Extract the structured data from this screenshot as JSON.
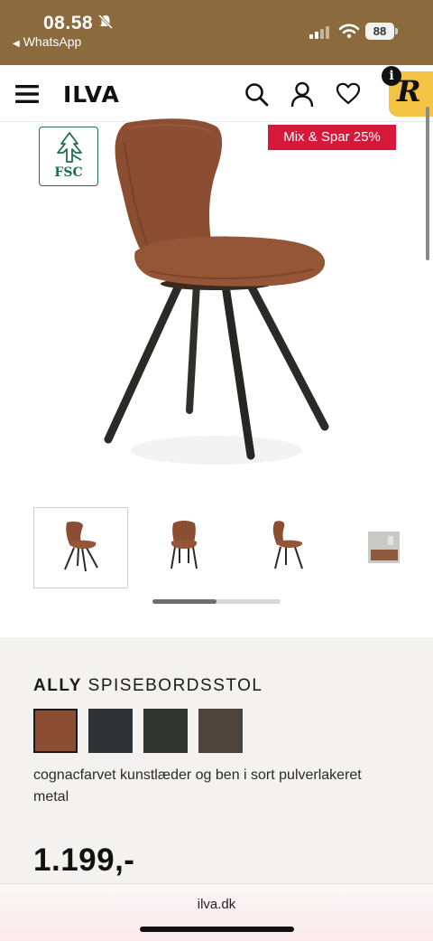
{
  "status_bar": {
    "time": "08.58",
    "back_app": "WhatsApp",
    "battery": "88"
  },
  "header": {
    "logo": "ILVA",
    "icons": [
      "menu-icon",
      "search-icon",
      "account-icon",
      "heart-icon"
    ],
    "rewards_badge": "R",
    "info_badge": "i"
  },
  "product": {
    "fsc_label": "FSC",
    "promo_label": "Mix & Spar 25%",
    "name_brand": "ALLY",
    "name_type": "SPISEBORDSSTOL",
    "description": "cognacfarvet kunstlæder og ben i sort pulverlakeret metal",
    "price": "1.199,-",
    "gallery_progress": 0.5,
    "swatch_colors": [
      "#8b4e33",
      "#303336",
      "#333533",
      "#4d433d"
    ]
  },
  "browser": {
    "url": "ilva.dk"
  },
  "colors": {
    "status_bar_bg": "#8b6a3e",
    "promo_bg": "#d6193b",
    "fsc_green": "#1f6e4d",
    "rewards_yellow": "#f5c344",
    "chair_leather": "#8b4e33"
  }
}
